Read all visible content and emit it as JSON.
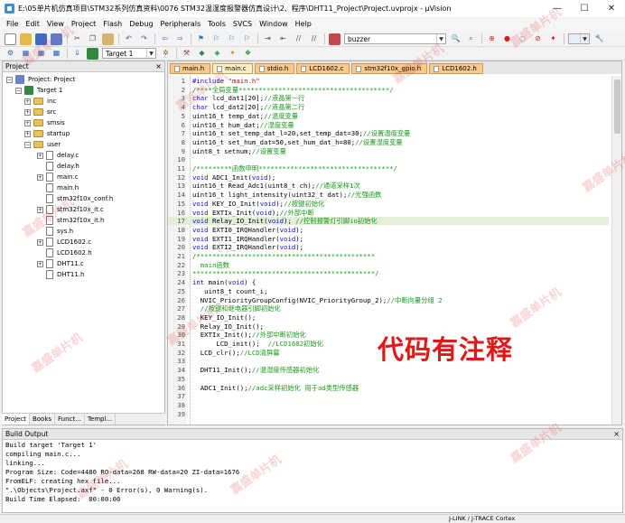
{
  "window": {
    "title": "E:\\05单片机仿真项目\\STM32系列仿真资料\\0076 STM32温湿度报警器仿真设计\\2、程序\\DHT11_Project\\Project.uvprojx - µVision"
  },
  "menubar": {
    "items": [
      "File",
      "Edit",
      "View",
      "Project",
      "Flash",
      "Debug",
      "Peripherals",
      "Tools",
      "SVCS",
      "Window",
      "Help"
    ]
  },
  "toolbar": {
    "find_value": "buzzer",
    "target_value": "Target 1"
  },
  "project_panel": {
    "title": "Project",
    "close_glyph": "×",
    "root": "Project: Project",
    "target": "Target 1",
    "groups": [
      "inc",
      "src",
      "smsis",
      "startup",
      "user"
    ],
    "user_files": [
      "delay.c",
      "delay.h",
      "main.c",
      "main.h",
      "stm32f10x_conf.h",
      "stm32f10x_it.c",
      "stm32f10x_it.h",
      "sys.h",
      "LCD1602.c",
      "LCD1602.h",
      "DHT11.c",
      "DHT11.h"
    ],
    "tabs": [
      "Project",
      "Books",
      "Funct...",
      "Templ..."
    ]
  },
  "editor": {
    "tabs": [
      "main.h",
      "main.c",
      "stdio.h",
      "LCD1602.c",
      "stm32f10x_gpio.h",
      "LCD1602.h"
    ],
    "active_tab": "main.c",
    "lines": [
      {
        "n": "1",
        "parts": [
          {
            "t": "#include ",
            "c": "kw"
          },
          {
            "t": "\"main.h\"",
            "c": "str"
          }
        ]
      },
      {
        "n": "2",
        "parts": [
          {
            "t": "/****全局变量**************************************/",
            "c": "cm"
          }
        ]
      },
      {
        "n": "3",
        "parts": [
          {
            "t": "char",
            "c": "kw"
          },
          {
            "t": " lcd_dat1[20];",
            "c": ""
          },
          {
            "t": "//液晶第一行",
            "c": "cm"
          }
        ]
      },
      {
        "n": "4",
        "parts": [
          {
            "t": "char",
            "c": "kw"
          },
          {
            "t": " lcd_dat2[20];",
            "c": ""
          },
          {
            "t": "//液晶第二行",
            "c": "cm"
          }
        ]
      },
      {
        "n": "5",
        "parts": [
          {
            "t": "uint16_t temp_dat;",
            "c": ""
          },
          {
            "t": "//温度变量",
            "c": "cm"
          }
        ]
      },
      {
        "n": "6",
        "parts": [
          {
            "t": "uint16_t hum_dat;",
            "c": ""
          },
          {
            "t": "//湿度变量",
            "c": "cm"
          }
        ]
      },
      {
        "n": "7",
        "parts": [
          {
            "t": "uint16_t set_temp_dat_l=20,set_temp_dat=30;",
            "c": ""
          },
          {
            "t": "//设置温度变量",
            "c": "cm"
          }
        ]
      },
      {
        "n": "8",
        "parts": [
          {
            "t": "uint16_t set_hum_dat=50,set_hum_dat_h=80;",
            "c": ""
          },
          {
            "t": "//设置湿度变量",
            "c": "cm"
          }
        ]
      },
      {
        "n": "9",
        "parts": [
          {
            "t": "uint8_t setnum;",
            "c": ""
          },
          {
            "t": "//设置变量",
            "c": "cm"
          }
        ]
      },
      {
        "n": "10",
        "parts": []
      },
      {
        "n": "11",
        "parts": [
          {
            "t": "/*********函数申明**********************************/",
            "c": "cm"
          }
        ]
      },
      {
        "n": "12",
        "parts": [
          {
            "t": "void",
            "c": "kw"
          },
          {
            "t": " ADC1_Init(",
            "c": ""
          },
          {
            "t": "void",
            "c": "kw"
          },
          {
            "t": ");",
            "c": ""
          }
        ]
      },
      {
        "n": "13",
        "parts": [
          {
            "t": "uint16_t Read_Adc1(uint8_t ch);",
            "c": ""
          },
          {
            "t": "//通道采样1次",
            "c": "cm"
          }
        ]
      },
      {
        "n": "14",
        "parts": [
          {
            "t": "uint16_t light_intensity(uint32_t dat);",
            "c": ""
          },
          {
            "t": "//光强函数",
            "c": "cm"
          }
        ]
      },
      {
        "n": "15",
        "parts": [
          {
            "t": "void",
            "c": "kw"
          },
          {
            "t": " KEY_IO_Init(",
            "c": ""
          },
          {
            "t": "void",
            "c": "kw"
          },
          {
            "t": ");",
            "c": ""
          },
          {
            "t": "//按键初始化",
            "c": "cm"
          }
        ]
      },
      {
        "n": "16",
        "parts": [
          {
            "t": "void",
            "c": "kw"
          },
          {
            "t": " EXTIx_Init(",
            "c": ""
          },
          {
            "t": "void",
            "c": "kw"
          },
          {
            "t": ");",
            "c": ""
          },
          {
            "t": "//外部中断",
            "c": "cm"
          }
        ]
      },
      {
        "n": "17",
        "parts": [
          {
            "t": "void",
            "c": "kw"
          },
          {
            "t": " Relay_IO_Init(",
            "c": ""
          },
          {
            "t": "void",
            "c": "kw"
          },
          {
            "t": "); ",
            "c": ""
          },
          {
            "t": "//控制报警灯引脚io初始化",
            "c": "cm"
          }
        ],
        "hl": true
      },
      {
        "n": "18",
        "parts": [
          {
            "t": "void",
            "c": "kw"
          },
          {
            "t": " EXTI0_IRQHandler(",
            "c": ""
          },
          {
            "t": "void",
            "c": "kw"
          },
          {
            "t": ");",
            "c": ""
          }
        ]
      },
      {
        "n": "19",
        "parts": [
          {
            "t": "void",
            "c": "kw"
          },
          {
            "t": " EXTI1_IRQHandler(",
            "c": ""
          },
          {
            "t": "void",
            "c": "kw"
          },
          {
            "t": ");",
            "c": ""
          }
        ]
      },
      {
        "n": "20",
        "parts": [
          {
            "t": "void",
            "c": "kw"
          },
          {
            "t": " EXTI2_IRQHandler(",
            "c": ""
          },
          {
            "t": "void",
            "c": "kw"
          },
          {
            "t": ");",
            "c": ""
          }
        ]
      },
      {
        "n": "21",
        "parts": [
          {
            "t": "/*********************************************",
            "c": "cm"
          }
        ]
      },
      {
        "n": "22",
        "parts": [
          {
            "t": "  main函数",
            "c": "cm"
          }
        ]
      },
      {
        "n": "23",
        "parts": [
          {
            "t": "**********************************************/",
            "c": "cm"
          }
        ]
      },
      {
        "n": "24",
        "parts": [
          {
            "t": "int",
            "c": "kw"
          },
          {
            "t": " main(",
            "c": ""
          },
          {
            "t": "void",
            "c": "kw"
          },
          {
            "t": ") {",
            "c": ""
          }
        ]
      },
      {
        "n": "25",
        "parts": [
          {
            "t": "   uint8_t count_i;",
            "c": ""
          }
        ]
      },
      {
        "n": "26",
        "parts": [
          {
            "t": "  NVIC_PriorityGroupConfig(NVIC_PriorityGroup_2);",
            "c": ""
          },
          {
            "t": "//中断向量分组 2",
            "c": "cm"
          }
        ]
      },
      {
        "n": "27",
        "parts": [
          {
            "t": "  ",
            "c": ""
          },
          {
            "t": "//按键和继电器引脚初始化",
            "c": "cm"
          }
        ]
      },
      {
        "n": "28",
        "parts": [
          {
            "t": "  KEY_IO_Init();",
            "c": ""
          }
        ]
      },
      {
        "n": "29",
        "parts": [
          {
            "t": "  Relay_IO_Init();",
            "c": ""
          }
        ]
      },
      {
        "n": "30",
        "parts": [
          {
            "t": "  EXTIx_Init();",
            "c": ""
          },
          {
            "t": "//外部中断初始化",
            "c": "cm"
          }
        ]
      },
      {
        "n": "31",
        "parts": [
          {
            "t": "      LCD_init();  ",
            "c": ""
          },
          {
            "t": "//LCD1602初始化",
            "c": "cm"
          }
        ]
      },
      {
        "n": "32",
        "parts": [
          {
            "t": "  LCD_clr();",
            "c": ""
          },
          {
            "t": "//LCD清屏幕",
            "c": "cm"
          }
        ]
      },
      {
        "n": "33",
        "parts": []
      },
      {
        "n": "34",
        "parts": [
          {
            "t": "  DHT11_Init();",
            "c": ""
          },
          {
            "t": "//温湿度传感器初始化",
            "c": "cm"
          }
        ]
      },
      {
        "n": "35",
        "parts": []
      },
      {
        "n": "36",
        "parts": [
          {
            "t": "  ADC1_Init();",
            "c": ""
          },
          {
            "t": "//adc采样初始化 用于ad类型传感器",
            "c": "cm"
          }
        ]
      },
      {
        "n": "37",
        "parts": []
      },
      {
        "n": "38",
        "parts": []
      },
      {
        "n": "39",
        "parts": []
      }
    ]
  },
  "overlay_text": "代码有注释",
  "output": {
    "title": "Build Output",
    "lines": [
      "Build target 'Target 1'",
      "compiling main.c...",
      "linking...",
      "Program Size: Code=4480 RO-data=268 RW-data=20 ZI-data=1676",
      "FromELF: creating hex file...",
      "\".\\Objects\\Project.axf\" - 0 Error(s), 0 Warning(s).",
      "Build Time Elapsed:  00:00:00"
    ]
  },
  "status": {
    "debugger": "J-LINK / J-TRACE Cortex"
  },
  "watermark_text": "嘉盛单片机",
  "colors": {
    "keyword": "#1010c8",
    "comment": "#1a9a1a",
    "string": "#a31515",
    "tab_bg": "#f9c98d",
    "highlight_line": "#e2f0da",
    "overlay": "#e01818"
  }
}
